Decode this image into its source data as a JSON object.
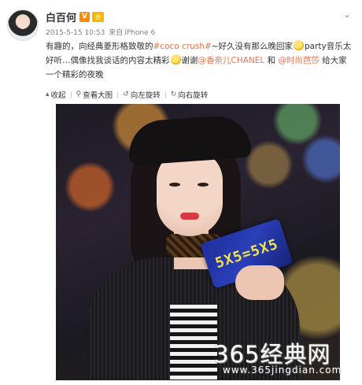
{
  "post": {
    "author": "白百何",
    "verified_badge": "V",
    "vip_badge": "会",
    "date": "2015-5-15 10:53",
    "source_prefix": "来自",
    "source": "iPhone 6",
    "text_1": "有趣的，向经典菱形格致敬的",
    "link_coco": "#coco crush#",
    "text_2": "~好久没有那么晚回家",
    "text_3": "party音乐太好听…偶像找我谈话的内容太精彩",
    "text_4": "谢谢",
    "link_chanel": "@香奈儿CHANEL",
    "text_5": " 和 ",
    "link_fashion": "@时尚芭莎",
    "text_6": " 给大家一个精彩的夜晚"
  },
  "toolbar": {
    "collapse": "收起",
    "view_large": "查看大图",
    "rotate_left": "向左旋转",
    "rotate_right": "向右旋转"
  },
  "photo": {
    "clutch_text": "5X5=5X5"
  },
  "watermark": {
    "main": "365经典网",
    "sub": "www.365jingdian.com"
  },
  "colors": {
    "link": "#eb7350",
    "meta": "#808080",
    "text": "#333333"
  },
  "icons": [
    "expand-icon",
    "collapse-icon",
    "zoom-icon",
    "rotate-left-icon",
    "rotate-right-icon",
    "emoji-icon"
  ]
}
